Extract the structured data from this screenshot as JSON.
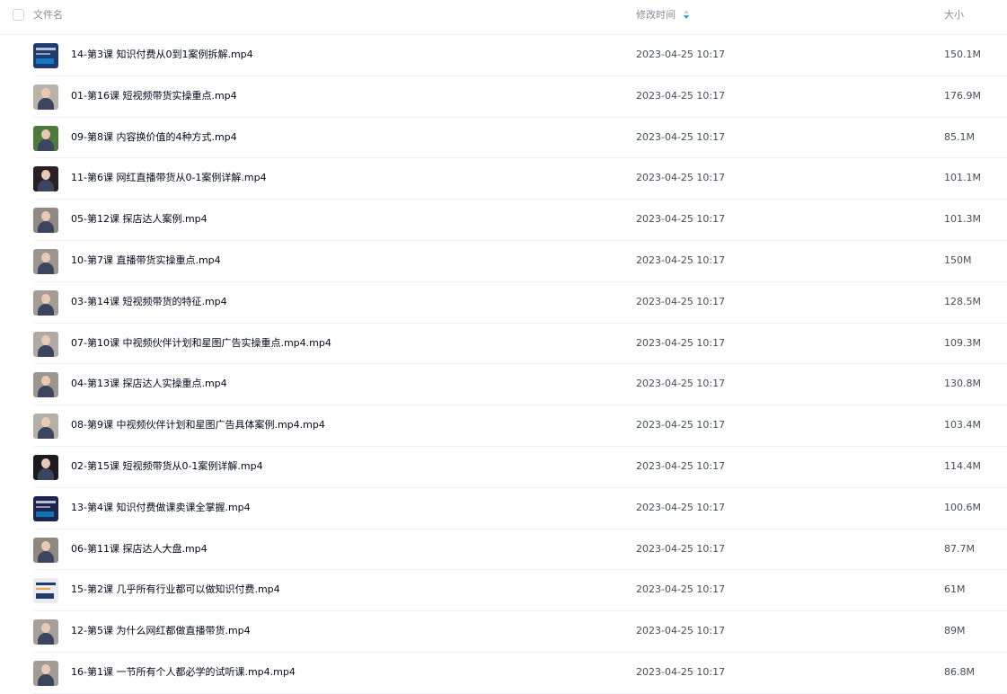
{
  "header": {
    "name_label": "文件名",
    "time_label": "修改时间",
    "size_label": "大小",
    "sort_column": "修改时间",
    "sort_icon": "sort-desc-icon",
    "accent_color": "#06a7ff"
  },
  "files": [
    {
      "name": "14-第3课 知识付费从0到1案例拆解.mp4",
      "modified": "2023-04-25 10:17",
      "size": "150.1M",
      "thumb": "slide",
      "thumb_bg": "#1e3a6e"
    },
    {
      "name": "01-第16课 短视频带货实操重点.mp4",
      "modified": "2023-04-25 10:17",
      "size": "176.9M",
      "thumb": "person",
      "thumb_bg": "#b9b3a8"
    },
    {
      "name": "09-第8课 内容换价值的4种方式.mp4",
      "modified": "2023-04-25 10:17",
      "size": "85.1M",
      "thumb": "person",
      "thumb_bg": "#4c7a3a"
    },
    {
      "name": "11-第6课 网红直播带货从0-1案例详解.mp4",
      "modified": "2023-04-25 10:17",
      "size": "101.1M",
      "thumb": "person",
      "thumb_bg": "#2a1f24"
    },
    {
      "name": "05-第12课 探店达人案例.mp4",
      "modified": "2023-04-25 10:17",
      "size": "101.3M",
      "thumb": "person",
      "thumb_bg": "#8f8a84"
    },
    {
      "name": "10-第7课 直播带货实操重点.mp4",
      "modified": "2023-04-25 10:17",
      "size": "150M",
      "thumb": "person",
      "thumb_bg": "#9a958f"
    },
    {
      "name": "03-第14课 短视频带货的特征.mp4",
      "modified": "2023-04-25 10:17",
      "size": "128.5M",
      "thumb": "person",
      "thumb_bg": "#a39d95"
    },
    {
      "name": "07-第10课 中视频伙伴计划和星图广告实操重点.mp4.mp4",
      "modified": "2023-04-25 10:17",
      "size": "109.3M",
      "thumb": "person",
      "thumb_bg": "#b0aaa2"
    },
    {
      "name": "04-第13课 探店达人实操重点.mp4",
      "modified": "2023-04-25 10:17",
      "size": "130.8M",
      "thumb": "person",
      "thumb_bg": "#9c968e"
    },
    {
      "name": "08-第9课 中视频伙伴计划和星图广告具体案例.mp4.mp4",
      "modified": "2023-04-25 10:17",
      "size": "103.4M",
      "thumb": "person",
      "thumb_bg": "#b5afa7"
    },
    {
      "name": "02-第15课 短视频带货从0-1案例详解.mp4",
      "modified": "2023-04-25 10:17",
      "size": "114.4M",
      "thumb": "person",
      "thumb_bg": "#1c1a1f"
    },
    {
      "name": "13-第4课 知识付费做课卖课全掌握.mp4",
      "modified": "2023-04-25 10:17",
      "size": "100.6M",
      "thumb": "slide",
      "thumb_bg": "#1b2550"
    },
    {
      "name": "06-第11课 探店达人大盘.mp4",
      "modified": "2023-04-25 10:17",
      "size": "87.7M",
      "thumb": "person",
      "thumb_bg": "#8e8880"
    },
    {
      "name": "15-第2课 几乎所有行业都可以做知识付费.mp4",
      "modified": "2023-04-25 10:17",
      "size": "61M",
      "thumb": "slide",
      "thumb_bg": "#e9ecf3"
    },
    {
      "name": "12-第5课 为什么网红都做直播带货.mp4",
      "modified": "2023-04-25 10:17",
      "size": "89M",
      "thumb": "person",
      "thumb_bg": "#a6a098"
    },
    {
      "name": "16-第1课 一节所有个人都必学的试听课.mp4.mp4",
      "modified": "2023-04-25 10:17",
      "size": "86.8M",
      "thumb": "person",
      "thumb_bg": "#a29c94"
    }
  ]
}
